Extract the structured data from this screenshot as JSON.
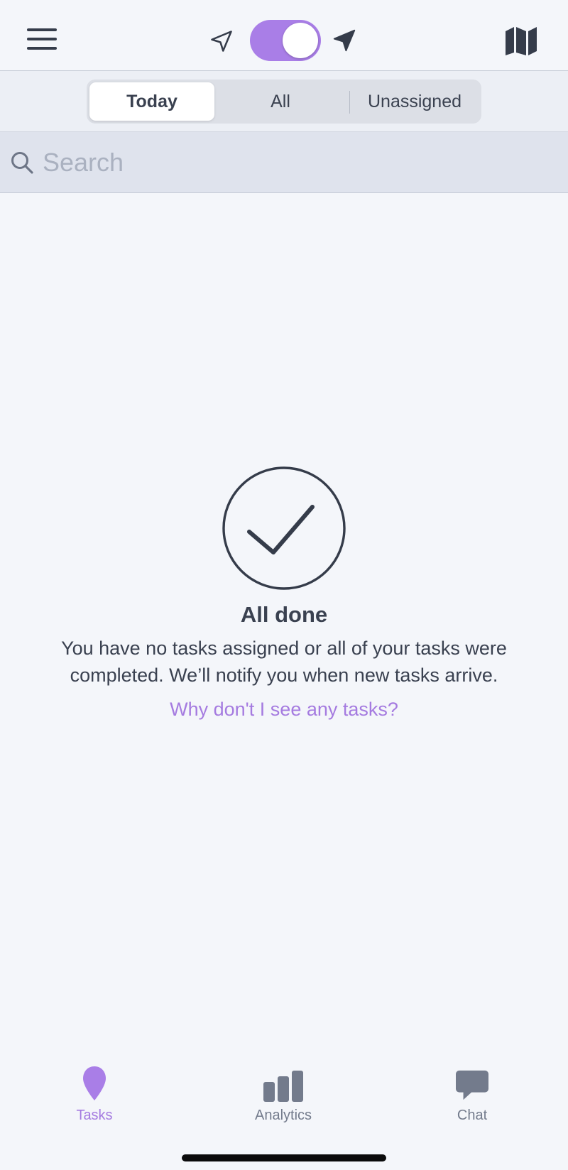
{
  "colors": {
    "accent": "#a97ee7",
    "link": "#a57be0",
    "text": "#3a4150",
    "muted": "#737b8c",
    "background": "#f4f6fa"
  },
  "topbar": {
    "menu_icon": "hamburger-menu-icon",
    "nav_outline_icon": "navigation-arrow-outline-icon",
    "nav_filled_icon": "navigation-arrow-filled-icon",
    "toggle_on": true,
    "map_icon": "map-icon"
  },
  "segments": {
    "today": "Today",
    "all": "All",
    "unassigned": "Unassigned",
    "selected": "Today"
  },
  "search": {
    "placeholder": "Search",
    "value": ""
  },
  "empty_state": {
    "icon": "check-circle-icon",
    "title": "All done",
    "message": "You have no tasks assigned or all of your tasks were completed. We’ll notify you when new tasks arrive.",
    "link": "Why don't I see any tasks?"
  },
  "tabs": {
    "tasks": {
      "label": "Tasks",
      "icon": "map-pin-icon",
      "active": true
    },
    "analytics": {
      "label": "Analytics",
      "icon": "bar-chart-icon",
      "active": false
    },
    "chat": {
      "label": "Chat",
      "icon": "chat-bubble-icon",
      "active": false
    }
  }
}
